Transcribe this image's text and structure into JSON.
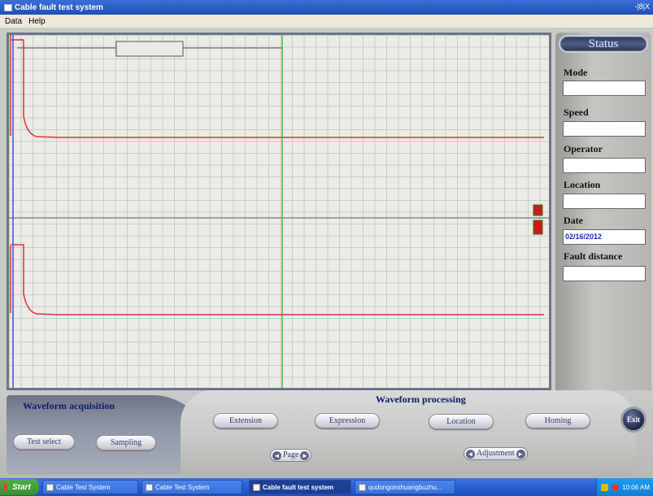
{
  "window": {
    "title": "Cable fault test system",
    "controls": "-|8|X"
  },
  "menu": [
    "Data",
    "Help"
  ],
  "status_panel": {
    "title": "Status",
    "fields": [
      {
        "label": "Mode",
        "value": ""
      },
      {
        "label": "Speed",
        "value": ""
      },
      {
        "label": "Operator",
        "value": ""
      },
      {
        "label": "Location",
        "value": ""
      },
      {
        "label": "Date",
        "value": "02/16/2012"
      },
      {
        "label": "Fault distance",
        "value": ""
      }
    ]
  },
  "acquisition": {
    "title": "Waveform acquisition",
    "buttons": {
      "test_select": "Test select",
      "sampling": "Sampling"
    }
  },
  "processing": {
    "title": "Waveform processing",
    "buttons": {
      "extension": "Extension",
      "expression": "Expression",
      "location": "Location",
      "homing": "Homing"
    },
    "page_label": "Page",
    "adjustment_label": "Adjustment"
  },
  "exit_label": "Exit",
  "taskbar": {
    "start": "Start",
    "tasks": [
      "Cable Test System",
      "Cable Test System",
      "Cable fault test system",
      "qudongonshuangbuzhu..."
    ],
    "clock": "10:06 AM"
  },
  "colors": {
    "trace": "#e03030",
    "cursor_green": "#40c040",
    "cursor_blue": "#4050e0",
    "marker": "#d01818"
  }
}
